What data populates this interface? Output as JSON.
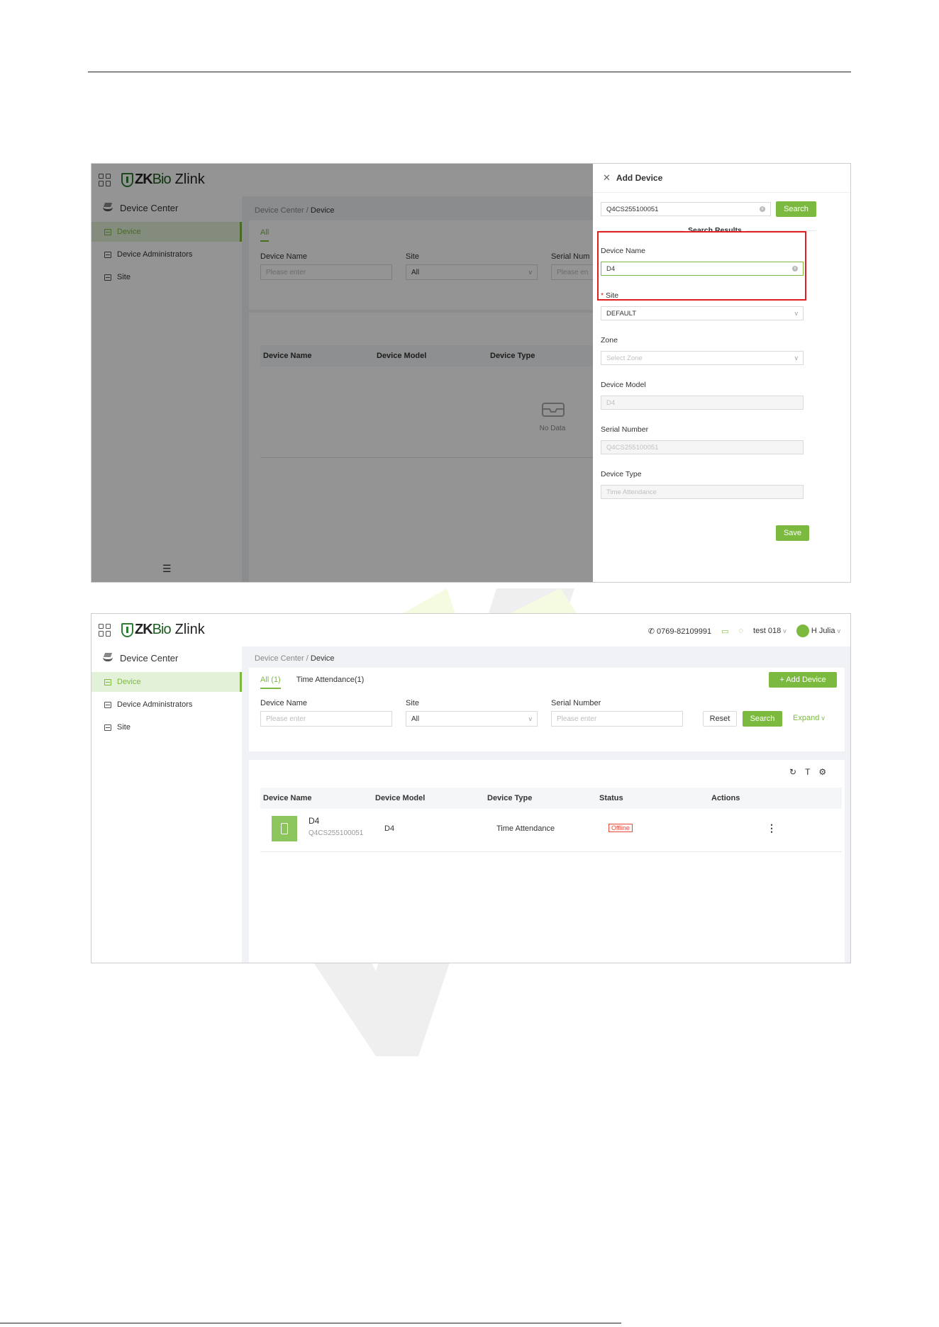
{
  "app": {
    "logo_brand_zk": "ZK",
    "logo_brand_bio": "Bio",
    "logo_brand_zlink": "Zlink"
  },
  "sidebar": {
    "section": "Device Center",
    "items": [
      {
        "label": "Device"
      },
      {
        "label": "Device Administrators"
      },
      {
        "label": "Site"
      }
    ]
  },
  "breadcrumb": {
    "parent": "Device Center",
    "sep": "/",
    "current": "Device"
  },
  "screen1": {
    "tab_all": "All",
    "filters": {
      "device_name_label": "Device Name",
      "device_name_placeholder": "Please enter",
      "site_label": "Site",
      "site_value": "All",
      "serial_label": "Serial Num",
      "serial_placeholder": "Please en"
    },
    "table_headers": [
      "Device Name",
      "Device Model",
      "Device Type"
    ],
    "no_data": "No Data",
    "drawer": {
      "title": "Add Device",
      "search_value": "Q4CS255100051",
      "search_button": "Search",
      "results_title": "Search Results",
      "device_name_label": "Device Name",
      "device_name_value": "D4",
      "site_required": "*",
      "site_label": "Site",
      "site_value": "DEFAULT",
      "zone_label": "Zone",
      "zone_placeholder": "Select Zone",
      "model_label": "Device Model",
      "model_value": "D4",
      "serial_label": "Serial Number",
      "serial_value": "Q4CS255100051",
      "type_label": "Device Type",
      "type_value": "Time Attendance",
      "save_button": "Save"
    }
  },
  "screen2": {
    "header": {
      "phone": "0769-82109991",
      "org": "test 018",
      "user": "H Julia"
    },
    "tabs": [
      {
        "label": "All (1)"
      },
      {
        "label": "Time Attendance(1)"
      }
    ],
    "add_device_button": "+ Add Device",
    "filters": {
      "device_name_label": "Device Name",
      "device_name_placeholder": "Please enter",
      "site_label": "Site",
      "site_value": "All",
      "serial_label": "Serial Number",
      "serial_placeholder": "Please enter",
      "reset": "Reset",
      "search": "Search",
      "expand": "Expand"
    },
    "table_headers": [
      "Device Name",
      "Device Model",
      "Device Type",
      "Status",
      "Actions"
    ],
    "rows": [
      {
        "name": "D4",
        "serial": "Q4CS255100051",
        "model": "D4",
        "type": "Time Attendance",
        "status": "Offline"
      }
    ]
  },
  "colors": {
    "accent": "#7cba3f",
    "highlight": "#e02020",
    "offline": "#e84c3d"
  }
}
